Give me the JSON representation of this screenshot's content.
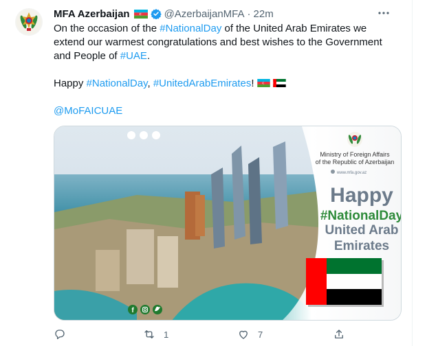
{
  "tweet": {
    "display_name": "MFA Azerbaijan",
    "handle": "@AzerbaijanMFA",
    "separator": "·",
    "time": "22m",
    "line1_pre": "On the occasion of the ",
    "line1_tag": "#NationalDay",
    "line1_post": " of the United Arab Emirates we extend our warmest congratulations and best wishes to the Government and People of ",
    "line1_tag2": "#UAE",
    "line1_end": ".",
    "line2_pre": "Happy ",
    "line2_tag1": "#NationalDay",
    "line2_sep": ", ",
    "line2_tag2": "#UnitedArabEmirates",
    "line2_end": "!",
    "mention": "@MoFAICUAE"
  },
  "media": {
    "ministry_line1": "Ministry of Foreign Affairs",
    "ministry_line2": "of the Republic of Azerbaijan",
    "ministry_site": "www.mfa.gov.az",
    "happy": "Happy",
    "hashtag": "#NationalDay",
    "country1": "United Arab",
    "country2": "Emirates"
  },
  "actions": {
    "replies": "",
    "retweets": "1",
    "likes": "7"
  },
  "icons": [
    "emblem-icon",
    "azerbaijan-flag-icon",
    "verified-icon",
    "more-icon",
    "uae-flag-icon",
    "reply-icon",
    "retweet-icon",
    "like-icon",
    "share-icon",
    "facebook-icon",
    "instagram-icon",
    "twitter-icon"
  ],
  "colors": {
    "link": "#1d9bf0",
    "muted": "#536471",
    "green": "#2e8b3a",
    "banner_text": "#6b7a8a"
  }
}
